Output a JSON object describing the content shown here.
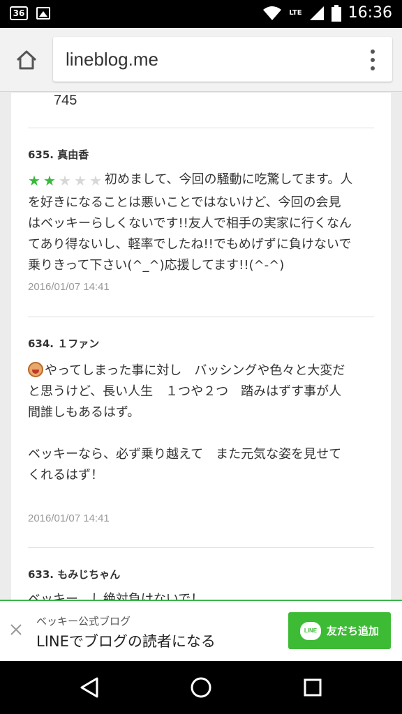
{
  "status_bar": {
    "notification_badge": "36",
    "network": "LTE",
    "time": "16:36"
  },
  "browser": {
    "url": "lineblog.me"
  },
  "comments_top": {
    "count_text": "745"
  },
  "comments": [
    {
      "number": "635.",
      "author": "真由香",
      "rating": 2,
      "rating_max": 5,
      "lines": [
        "初めまして、今回の騒動に吃驚してます。人",
        "を好きになることは悪いことではないけど、今回の会見",
        "はベッキーらしくないです!!友人で相手の実家に行くなん",
        "てあり得ないし、軽率でしたね!!でもめげずに負けないで",
        "乗りきって下さい(^_^)応援してます!!(^-^)"
      ],
      "date": "2016/01/07 14:41"
    },
    {
      "number": "634.",
      "author": "１ファン",
      "lines": [
        "やってしまった事に対し　バッシングや色々と大変だ",
        "と思うけど、長い人生　１つや２つ　踏みはずす事が人",
        "間誰しもあるはず。",
        "",
        "ベッキーなら、必ず乗り越えて　また元気な姿を見せて",
        "くれるはず！"
      ],
      "date": "2016/01/07 14:41"
    },
    {
      "number": "633.",
      "author": "もみじちゃん",
      "partial_line": "ベッキー、し絶対負けないで！"
    }
  ],
  "line_banner": {
    "subtitle": "ベッキー公式ブログ",
    "title": "LINEでブログの読者になる",
    "logo_text": "LINE",
    "button_label": "友だち追加",
    "accent_color": "#3dbb35"
  },
  "icons": [
    "home-icon",
    "overflow-menu-icon",
    "close-icon",
    "back-icon",
    "home-circle-icon",
    "recents-icon",
    "wifi-icon",
    "signal-icon",
    "battery-icon",
    "image-icon"
  ]
}
